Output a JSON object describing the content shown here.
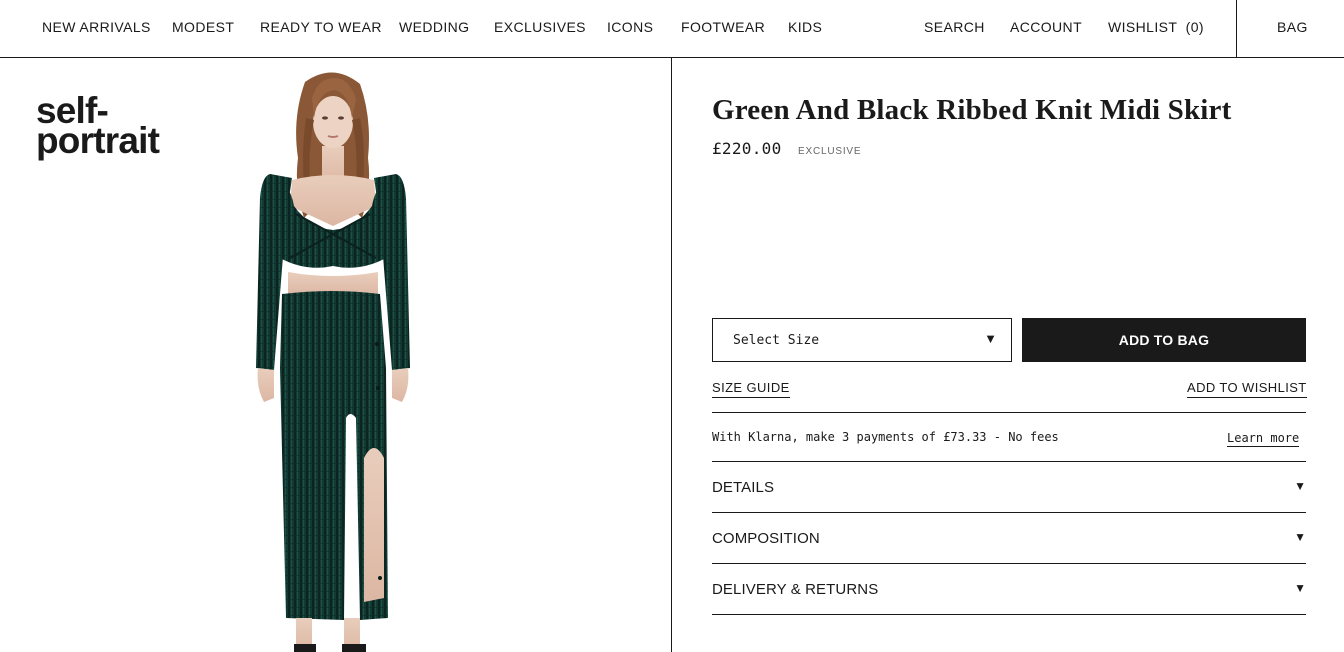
{
  "nav": {
    "links": [
      "NEW ARRIVALS",
      "MODEST",
      "READY TO WEAR",
      "WEDDING",
      "EXCLUSIVES",
      "ICONS",
      "FOOTWEAR",
      "KIDS"
    ],
    "search": "SEARCH",
    "account": "ACCOUNT",
    "wishlist": "WISHLIST  (0)",
    "bag": "BAG"
  },
  "brand": {
    "line1": "self-",
    "line2": "portrait"
  },
  "product": {
    "title": "Green And Black Ribbed Knit Midi Skirt",
    "price": "£220.00",
    "badge": "EXCLUSIVE",
    "image_alt": "Model wearing green and black ribbed knit crop top and midi skirt"
  },
  "purchase": {
    "size_select": "Select Size",
    "add_to_bag": "ADD TO BAG",
    "size_guide": "SIZE GUIDE",
    "add_to_wishlist": "ADD TO WISHLIST"
  },
  "klarna": {
    "text": "With Klarna, make 3 payments of £73.33 - No fees",
    "link": "Learn more"
  },
  "accordions": [
    "DETAILS",
    "COMPOSITION",
    "DELIVERY & RETURNS"
  ],
  "icons": {
    "dropdown": "triangle-down-icon",
    "accordion": "triangle-down-icon"
  },
  "colors": {
    "ink": "#1a1a1a",
    "knit": "#123a33",
    "knit_dark": "#0b2420",
    "button_bg": "#1a1a1a"
  }
}
